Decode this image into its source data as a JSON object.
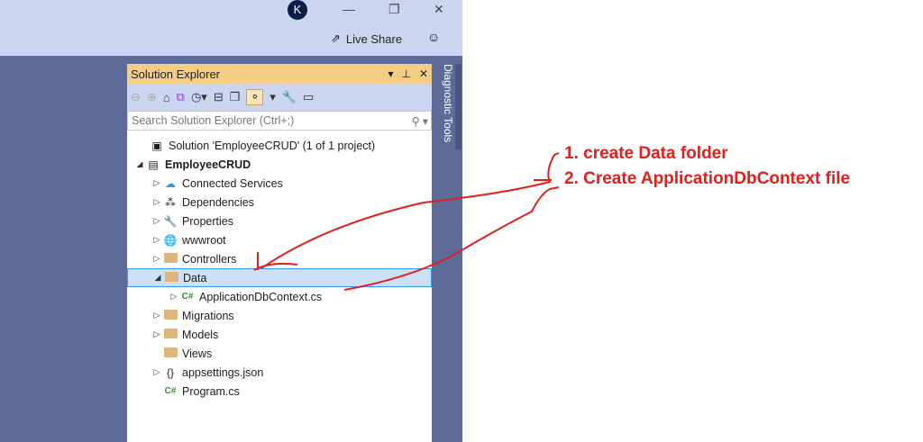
{
  "window": {
    "avatar": "K",
    "minimize": "—",
    "restore": "❐",
    "close": "✕",
    "live_share": "Live Share"
  },
  "panel": {
    "title": "Solution Explorer",
    "search_placeholder": "Search Solution Explorer (Ctrl+;)",
    "side_tab": "Diagnostic Tools"
  },
  "tree": [
    {
      "label": "Solution 'EmployeeCRUD' (1 of 1 project)",
      "icon": "solution-icon",
      "indent": 0,
      "arrow": ""
    },
    {
      "label": "EmployeeCRUD",
      "icon": "project-icon",
      "indent": 0,
      "arrow": "◢",
      "bold": true
    },
    {
      "label": "Connected Services",
      "icon": "cloud-icon",
      "indent": 1,
      "arrow": "▷"
    },
    {
      "label": "Dependencies",
      "icon": "dependencies-icon",
      "indent": 1,
      "arrow": "▷"
    },
    {
      "label": "Properties",
      "icon": "wrench-icon",
      "indent": 1,
      "arrow": "▷"
    },
    {
      "label": "wwwroot",
      "icon": "globe-icon",
      "indent": 1,
      "arrow": "▷"
    },
    {
      "label": "Controllers",
      "icon": "folder-icon",
      "indent": 1,
      "arrow": "▷"
    },
    {
      "label": "Data",
      "icon": "folder-open-icon",
      "indent": 1,
      "arrow": "◢",
      "selected": true
    },
    {
      "label": "ApplicationDbContext.cs",
      "icon": "csharp-icon",
      "indent": 2,
      "arrow": "▷"
    },
    {
      "label": "Migrations",
      "icon": "folder-icon",
      "indent": 1,
      "arrow": "▷"
    },
    {
      "label": "Models",
      "icon": "folder-icon",
      "indent": 1,
      "arrow": "▷"
    },
    {
      "label": "Views",
      "icon": "folder-icon",
      "indent": 1,
      "arrow": ""
    },
    {
      "label": "appsettings.json",
      "icon": "json-icon",
      "indent": 1,
      "arrow": "▷"
    },
    {
      "label": "Program.cs",
      "icon": "csharp-icon",
      "indent": 1,
      "arrow": ""
    }
  ],
  "annotations": [
    "1. create Data folder",
    "2. Create ApplicationDbContext file"
  ],
  "colors": {
    "accent": "#f5cc84",
    "annotation": "#e0201c",
    "selection": "#cce0f7"
  }
}
